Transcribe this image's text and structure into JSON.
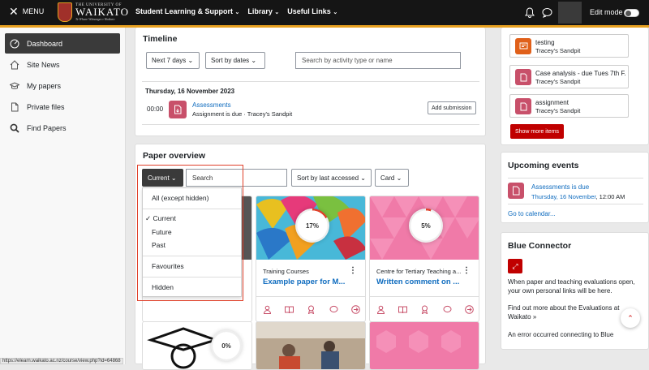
{
  "topbar": {
    "menu_label": "MENU",
    "logo_line1": "THE UNIVERSITY OF",
    "logo_line2": "WAIKATO",
    "logo_line3": "Te Whare Wānanga o Waikato",
    "nav": [
      "Student Learning & Support",
      "Library",
      "Useful Links"
    ],
    "edit_mode_label": "Edit mode",
    "edit_mode_on": false
  },
  "sidebar": {
    "items": [
      {
        "label": "Dashboard",
        "icon": "dashboard-icon",
        "active": true
      },
      {
        "label": "Site News",
        "icon": "home-icon"
      },
      {
        "label": "My papers",
        "icon": "graduation-cap-icon"
      },
      {
        "label": "Private files",
        "icon": "file-icon"
      },
      {
        "label": "Find Papers",
        "icon": "search-icon"
      }
    ]
  },
  "timeline": {
    "title": "Timeline",
    "filter_days": "Next 7 days",
    "sort": "Sort by dates",
    "search_placeholder": "Search by activity type or name",
    "date_heading": "Thursday, 16 November 2023",
    "event": {
      "time": "00:00",
      "name": "Assessments",
      "detail": "Assignment is due · Tracey's Sandpit",
      "action": "Add submission"
    }
  },
  "paper_overview": {
    "title": "Paper overview",
    "filter_selected": "Current",
    "search_placeholder": "Search",
    "sort": "Sort by last accessed",
    "view": "Card",
    "dropdown": {
      "all": "All (except hidden)",
      "current": "Current",
      "future": "Future",
      "past": "Past",
      "favourites": "Favourites",
      "hidden": "Hidden"
    },
    "cards": [
      {
        "category": "Training Courses",
        "name": "Example paper for M...",
        "progress": "17%",
        "progress_value": 17
      },
      {
        "category": "Centre for Tertiary Teaching a...",
        "name": "Written comment on ...",
        "progress": "5%",
        "progress_value": 5
      }
    ],
    "row2_progress": "0%"
  },
  "right": {
    "recent": [
      {
        "title": "testing",
        "sub": "Tracey's Sandpit",
        "color": "#e0601a"
      },
      {
        "title": "Case analysis - due Tues 7th F...",
        "sub": "Tracey's Sandpit",
        "color": "#c8506a"
      },
      {
        "title": "assignment",
        "sub": "Tracey's Sandpit",
        "color": "#c8506a"
      }
    ],
    "show_more": "Show more items",
    "upcoming": {
      "title": "Upcoming events",
      "event_name": "Assessments is due",
      "event_date": "Thursday, 16 November",
      "event_time": ", 12:00 AM",
      "goto": "Go to calendar..."
    },
    "blue": {
      "title": "Blue Connector",
      "p1": "When paper and teaching evaluations open, your own personal links will be here.",
      "p2": "Find out more about the Evaluations at Waikato »",
      "p3": "An error occurred connecting to Blue"
    }
  },
  "status_url": "https://elearn.waikato.ac.nz/course/view.php?id=64868",
  "colors": {
    "accent": "#e7a020",
    "link": "#0f6cbf",
    "danger": "#c00000",
    "dark": "#151515"
  }
}
